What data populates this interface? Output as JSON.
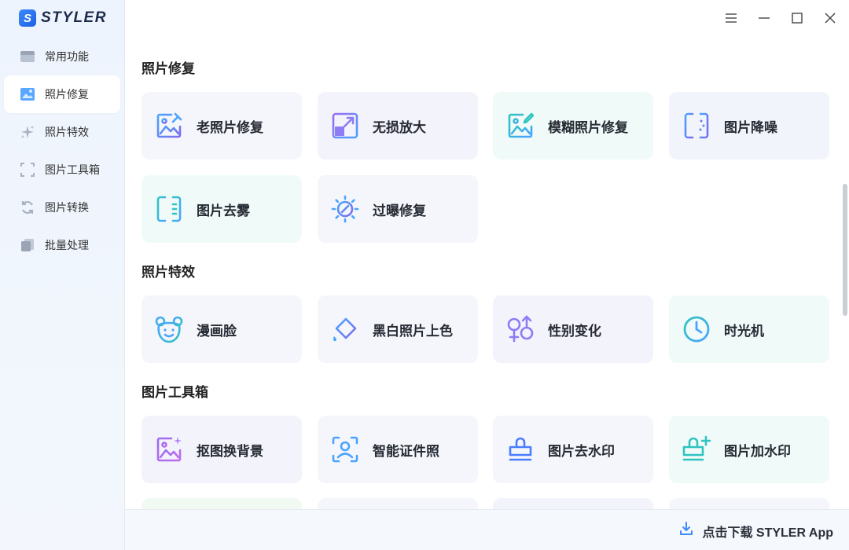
{
  "app": {
    "logo_letter": "S",
    "name": "STYLER"
  },
  "sidebar": {
    "items": [
      {
        "label": "常用功能",
        "icon": "common-functions-icon"
      },
      {
        "label": "照片修复",
        "icon": "photo-repair-icon",
        "active": true
      },
      {
        "label": "照片特效",
        "icon": "sparkle-icon"
      },
      {
        "label": "图片工具箱",
        "icon": "crop-frame-icon"
      },
      {
        "label": "图片转换",
        "icon": "convert-icon"
      },
      {
        "label": "批量处理",
        "icon": "batch-icon"
      }
    ]
  },
  "sections": [
    {
      "title": "照片修复",
      "cards": [
        {
          "label": "老照片修复",
          "icon": "old-photo-repair-icon"
        },
        {
          "label": "无损放大",
          "icon": "upscale-icon"
        },
        {
          "label": "模糊照片修复",
          "icon": "blur-photo-repair-icon"
        },
        {
          "label": "图片降噪",
          "icon": "denoise-icon"
        },
        {
          "label": "图片去雾",
          "icon": "dehaze-icon"
        },
        {
          "label": "过曝修复",
          "icon": "overexposure-icon"
        }
      ]
    },
    {
      "title": "照片特效",
      "cards": [
        {
          "label": "漫画脸",
          "icon": "cartoon-face-icon"
        },
        {
          "label": "黑白照片上色",
          "icon": "colorize-icon"
        },
        {
          "label": "性别变化",
          "icon": "gender-swap-icon"
        },
        {
          "label": "时光机",
          "icon": "clock-icon"
        }
      ]
    },
    {
      "title": "图片工具箱",
      "cards": [
        {
          "label": "抠图换背景",
          "icon": "cutout-background-icon"
        },
        {
          "label": "智能证件照",
          "icon": "id-photo-icon"
        },
        {
          "label": "图片去水印",
          "icon": "remove-watermark-icon"
        },
        {
          "label": "图片加水印",
          "icon": "add-watermark-icon"
        }
      ]
    }
  ],
  "bottom": {
    "download_label": "点击下载 STYLER App"
  },
  "colors": {
    "accent_blue": "#3a8bff",
    "accent_purple": "#7b6cf0",
    "accent_teal": "#2fc4c0"
  }
}
